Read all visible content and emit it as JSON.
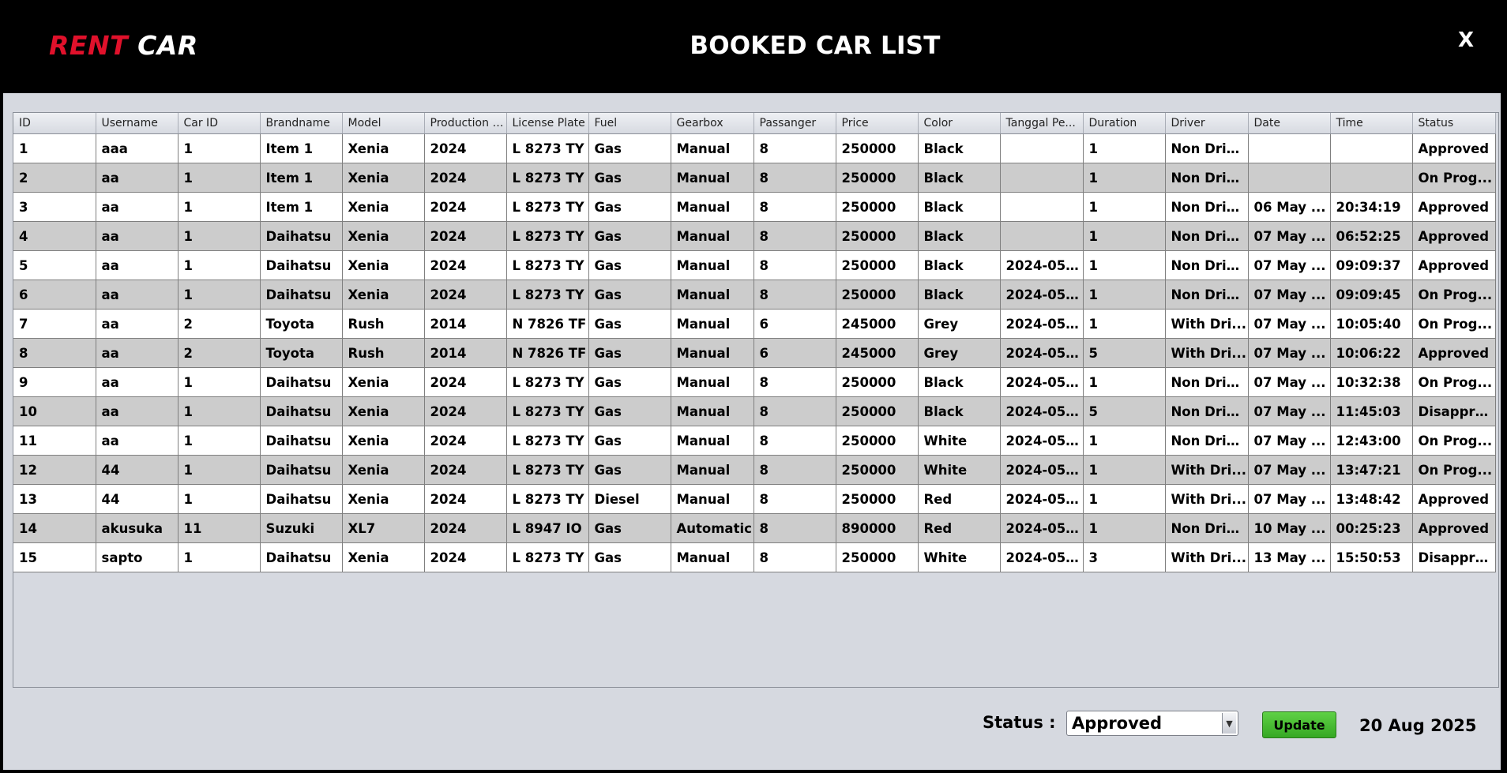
{
  "header": {
    "brand_rent": "RENT",
    "brand_car": "CAR",
    "title": "BOOKED CAR LIST",
    "close_label": "X",
    "colors": {
      "brand_red": "#e0112b",
      "background": "#000000"
    }
  },
  "table": {
    "columns": [
      "ID",
      "Username",
      "Car ID",
      "Brandname",
      "Model",
      "Production Y...",
      "License Plate",
      "Fuel",
      "Gearbox",
      "Passanger",
      "Price",
      "Color",
      "Tanggal Pe...",
      "Duration",
      "Driver",
      "Date",
      "Time",
      "Status"
    ],
    "rows": [
      [
        "1",
        "aaa",
        "1",
        "Item 1",
        "Xenia",
        "2024",
        "L 8273 TY",
        "Gas",
        "Manual",
        "8",
        "250000",
        "Black",
        "",
        "1",
        "Non Driver",
        "",
        "",
        "Approved"
      ],
      [
        "2",
        "aa",
        "1",
        "Item 1",
        "Xenia",
        "2024",
        "L 8273 TY",
        "Gas",
        "Manual",
        "8",
        "250000",
        "Black",
        "",
        "1",
        "Non Driver",
        "",
        "",
        "On Prog..."
      ],
      [
        "3",
        "aa",
        "1",
        "Item 1",
        "Xenia",
        "2024",
        "L 8273 TY",
        "Gas",
        "Manual",
        "8",
        "250000",
        "Black",
        "",
        "1",
        "Non Driver",
        "06 May ...",
        "20:34:19",
        "Approved"
      ],
      [
        "4",
        "aa",
        "1",
        "Daihatsu",
        "Xenia",
        "2024",
        "L 8273 TY",
        "Gas",
        "Manual",
        "8",
        "250000",
        "Black",
        "",
        "1",
        "Non Driver",
        "07 May ...",
        "06:52:25",
        "Approved"
      ],
      [
        "5",
        "aa",
        "1",
        "Daihatsu",
        "Xenia",
        "2024",
        "L 8273 TY",
        "Gas",
        "Manual",
        "8",
        "250000",
        "Black",
        "2024-05-...",
        "1",
        "Non Driver",
        "07 May ...",
        "09:09:37",
        "Approved"
      ],
      [
        "6",
        "aa",
        "1",
        "Daihatsu",
        "Xenia",
        "2024",
        "L 8273 TY",
        "Gas",
        "Manual",
        "8",
        "250000",
        "Black",
        "2024-05-...",
        "1",
        "Non Driver",
        "07 May ...",
        "09:09:45",
        "On Prog..."
      ],
      [
        "7",
        "aa",
        "2",
        "Toyota",
        "Rush",
        "2014",
        "N 7826 TF",
        "Gas",
        "Manual",
        "6",
        "245000",
        "Grey",
        "2024-05-...",
        "1",
        "With Dri...",
        "07 May ...",
        "10:05:40",
        "On Prog..."
      ],
      [
        "8",
        "aa",
        "2",
        "Toyota",
        "Rush",
        "2014",
        "N 7826 TF",
        "Gas",
        "Manual",
        "6",
        "245000",
        "Grey",
        "2024-05-...",
        "5",
        "With Dri...",
        "07 May ...",
        "10:06:22",
        "Approved"
      ],
      [
        "9",
        "aa",
        "1",
        "Daihatsu",
        "Xenia",
        "2024",
        "L 8273 TY",
        "Gas",
        "Manual",
        "8",
        "250000",
        "Black",
        "2024-05-...",
        "1",
        "Non Driver",
        "07 May ...",
        "10:32:38",
        "On Prog..."
      ],
      [
        "10",
        "aa",
        "1",
        "Daihatsu",
        "Xenia",
        "2024",
        "L 8273 TY",
        "Gas",
        "Manual",
        "8",
        "250000",
        "Black",
        "2024-05-...",
        "5",
        "Non Driver",
        "07 May ...",
        "11:45:03",
        "Disappro..."
      ],
      [
        "11",
        "aa",
        "1",
        "Daihatsu",
        "Xenia",
        "2024",
        "L 8273 TY",
        "Gas",
        "Manual",
        "8",
        "250000",
        "White",
        "2024-05-...",
        "1",
        "Non Driver",
        "07 May ...",
        "12:43:00",
        "On Prog..."
      ],
      [
        "12",
        "44",
        "1",
        "Daihatsu",
        "Xenia",
        "2024",
        "L 8273 TY",
        "Gas",
        "Manual",
        "8",
        "250000",
        "White",
        "2024-05-...",
        "1",
        "With Dri...",
        "07 May ...",
        "13:47:21",
        "On Prog..."
      ],
      [
        "13",
        "44",
        "1",
        "Daihatsu",
        "Xenia",
        "2024",
        "L 8273 TY",
        "Diesel",
        "Manual",
        "8",
        "250000",
        "Red",
        "2024-05-...",
        "1",
        "With Dri...",
        "07 May ...",
        "13:48:42",
        "Approved"
      ],
      [
        "14",
        "akusuka",
        "11",
        "Suzuki",
        "XL7",
        "2024",
        "L 8947 IO",
        "Gas",
        "Automatic",
        "8",
        "890000",
        "Red",
        "2024-05-...",
        "1",
        "Non Driver",
        "10 May ...",
        "00:25:23",
        "Approved"
      ],
      [
        "15",
        "sapto",
        "1",
        "Daihatsu",
        "Xenia",
        "2024",
        "L 8273 TY",
        "Gas",
        "Manual",
        "8",
        "250000",
        "White",
        "2024-05-...",
        "3",
        "With Dri...",
        "13 May ...",
        "15:50:53",
        "Disappro..."
      ]
    ]
  },
  "footer": {
    "status_label": "Status :",
    "status_value": "Approved",
    "update_label": "Update",
    "date": "20 Aug 2025",
    "colors": {
      "update_button": "#44bb2f"
    }
  }
}
